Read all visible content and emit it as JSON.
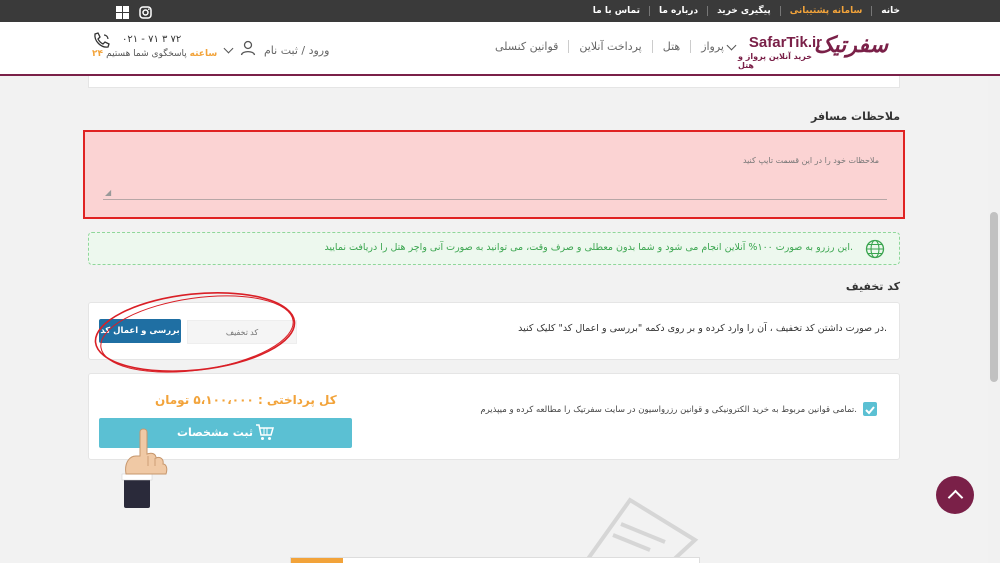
{
  "topnav": {
    "items": [
      "خانه",
      "سامانه پشتیبانی",
      "پیگیری خرید",
      "درباره ما",
      "تماس با ما"
    ],
    "active_index": 1
  },
  "social": {
    "icons": [
      "windows-icon",
      "instagram-icon"
    ]
  },
  "header": {
    "logo_script": "سفرتیک",
    "logo_brand": "SafarTik.ir",
    "logo_tagline": "خرید آنلاین پرواز و هتل",
    "nav": [
      "پرواز",
      "هتل",
      "پرداخت آنلاین",
      "قوانین کنسلی"
    ],
    "login": "ورود / ثبت نام",
    "support_phone": "۰۲۱ - ۷۱ ۳ ۷۲",
    "support_hours_bold": "۲۴ ساعته",
    "support_hours_text": "پاسخگوی شما هستیم"
  },
  "notes": {
    "title": "ملاحظات مسافر",
    "placeholder": "ملاحظات خود را در این قسمت تایپ کنید"
  },
  "info_banner": "این رزرو به صورت ۱۰۰% آنلاین انجام می شود و شما بدون معطلی و صرف وقت، می توانید به صورت آنی واچر هتل را دریافت نمایید.",
  "discount": {
    "title": "کد تخفیف",
    "description": "در صورت داشتن کد تخفیف ، آن را وارد کرده و بر روی دکمه \"بررسی و اعمال کد\" کلیک کنید.",
    "placeholder": "کد تخفیف",
    "button": "بررسی و اعمال کد"
  },
  "payment": {
    "terms": "تمامی قوانین مربوط به خرید الکترونیکی و قوانین رزرواسیون در سایت سفرتیک را مطالعه کرده و میپذیرم.",
    "terms_checked": true,
    "total": "کل پرداختی : ۵،۱۰۰،۰۰۰ تومان",
    "submit": "ثبت مشخصات"
  },
  "colors": {
    "brand": "#7a2048",
    "accent": "#f2a33a",
    "button_blue": "#1f6fa3",
    "submit_cyan": "#5bc0d3",
    "success_green": "#3aa54f",
    "error_red": "#e02222"
  }
}
